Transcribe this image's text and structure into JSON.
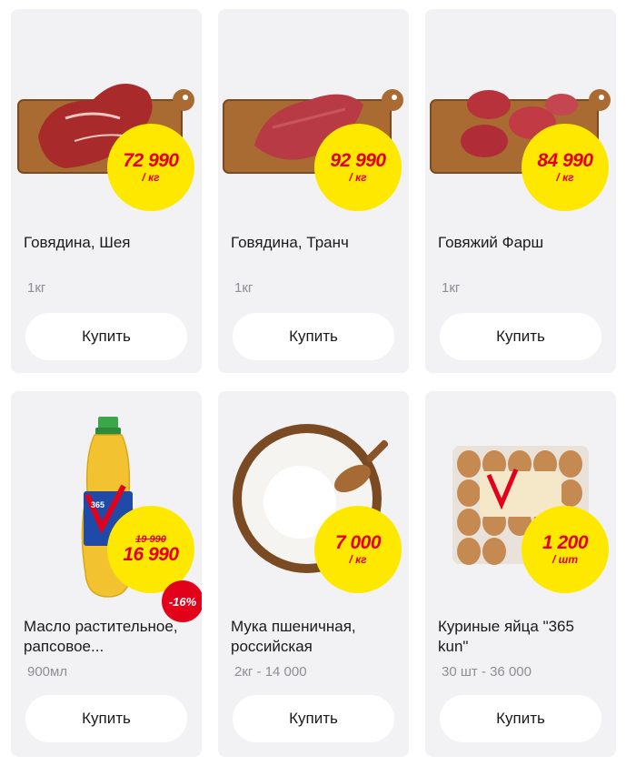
{
  "products": [
    {
      "name": "Говядина, Шея",
      "weight": "1кг",
      "price": "72 990",
      "unit": "/ кг",
      "old_price": "",
      "discount": "",
      "buy_label": "Купить",
      "image": "beef-neck-on-board"
    },
    {
      "name": "Говядина, Транч",
      "weight": "1кг",
      "price": "92 990",
      "unit": "/ кг",
      "old_price": "",
      "discount": "",
      "buy_label": "Купить",
      "image": "beef-tranche-on-board"
    },
    {
      "name": "Говяжий Фарш",
      "weight": "1кг",
      "price": "84 990",
      "unit": "/ кг",
      "old_price": "",
      "discount": "",
      "buy_label": "Купить",
      "image": "minced-beef-on-board"
    },
    {
      "name": "Масло растительное, рапсовое...",
      "weight": "900мл",
      "price": "16 990",
      "unit": "",
      "old_price": "19 990",
      "discount": "-16%",
      "buy_label": "Купить",
      "image": "oil-bottle"
    },
    {
      "name": "Мука пшеничная, российская",
      "weight": "2кг - 14 000",
      "price": "7 000",
      "unit": "/ кг",
      "old_price": "",
      "discount": "",
      "buy_label": "Купить",
      "image": "flour-bowl"
    },
    {
      "name": "Куриные яйца \"365 kun\"",
      "weight": "30 шт - 36 000",
      "price": "1 200",
      "unit": "/ шт",
      "old_price": "",
      "discount": "",
      "buy_label": "Купить",
      "image": "egg-tray"
    }
  ],
  "brand_colors": {
    "badge": "#ffe800",
    "price_text": "#e3001b",
    "card_bg": "#f2f2f4"
  }
}
